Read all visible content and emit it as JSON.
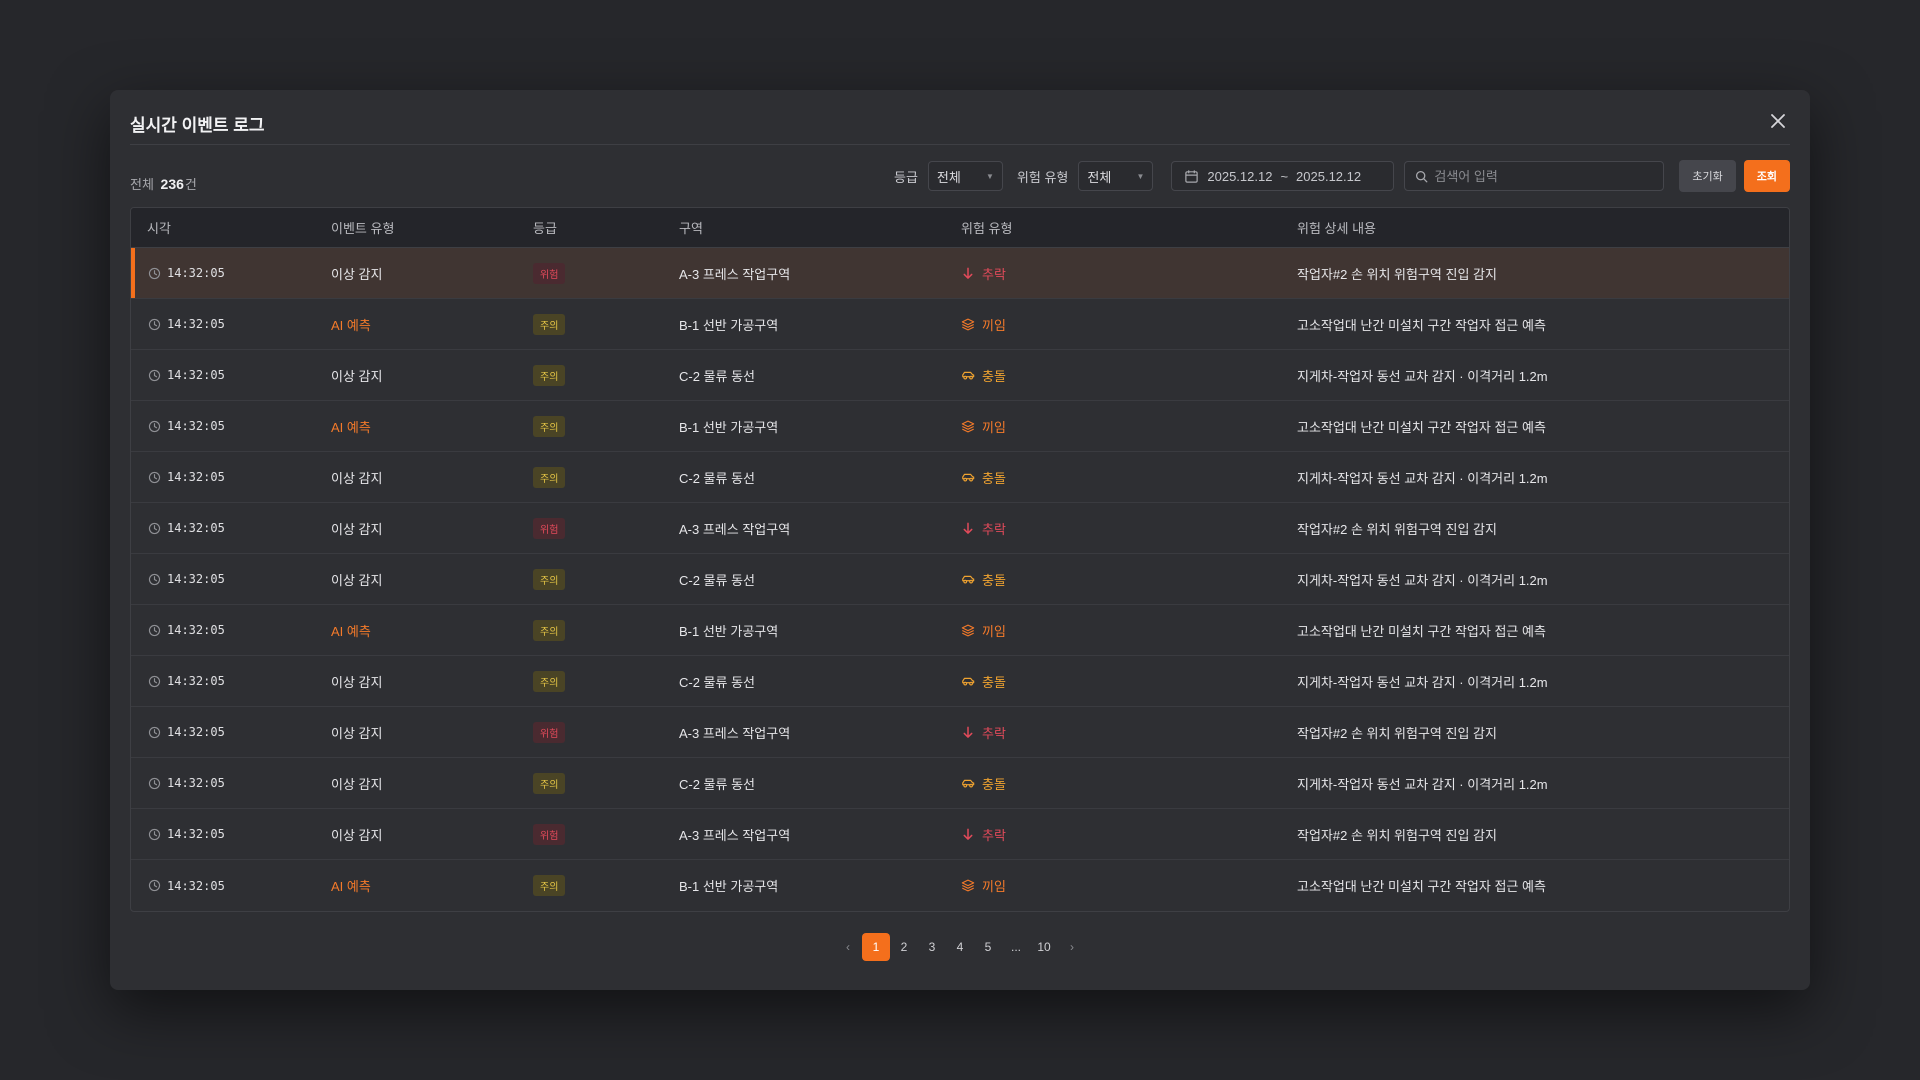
{
  "modal": {
    "title": "실시간 이벤트 로그"
  },
  "toolbar": {
    "total_prefix": "전체",
    "total_count": "236",
    "total_suffix": "건",
    "grade_label": "등급",
    "grade_value": "전체",
    "risk_label": "위험 유형",
    "risk_value": "전체",
    "date_start": "2025.12.12",
    "date_sep": "~",
    "date_end": "2025.12.12",
    "search_placeholder": "검색어 입력",
    "reset_label": "초기화",
    "search_label": "조회"
  },
  "table": {
    "headers": [
      "시각",
      "이벤트 유형",
      "등급",
      "구역",
      "위험 유형",
      "위험 상세 내용"
    ],
    "rows": [
      {
        "time": "14:32:05",
        "type": "이상 감지",
        "type_kind": "normal",
        "grade": "위험",
        "grade_kind": "danger",
        "zone": "A-3 프레스 작업구역",
        "risk": "추락",
        "risk_kind": "fall",
        "detail": "작업자#2 손 위치 위험구역 진입 감지",
        "highlight": true
      },
      {
        "time": "14:32:05",
        "type": "AI 예측",
        "type_kind": "ai",
        "grade": "주의",
        "grade_kind": "warn",
        "zone": "B-1 선반 가공구역",
        "risk": "끼임",
        "risk_kind": "caught",
        "detail": "고소작업대 난간 미설치 구간 작업자 접근 예측"
      },
      {
        "time": "14:32:05",
        "type": "이상 감지",
        "type_kind": "normal",
        "grade": "주의",
        "grade_kind": "warn",
        "zone": "C-2 물류 동선",
        "risk": "충돌",
        "risk_kind": "collision",
        "detail": "지게차-작업자 동선 교차 감지 · 이격거리 1.2m"
      },
      {
        "time": "14:32:05",
        "type": "AI 예측",
        "type_kind": "ai",
        "grade": "주의",
        "grade_kind": "warn",
        "zone": "B-1 선반 가공구역",
        "risk": "끼임",
        "risk_kind": "caught",
        "detail": "고소작업대 난간 미설치 구간 작업자 접근 예측"
      },
      {
        "time": "14:32:05",
        "type": "이상 감지",
        "type_kind": "normal",
        "grade": "주의",
        "grade_kind": "warn",
        "zone": "C-2 물류 동선",
        "risk": "충돌",
        "risk_kind": "collision",
        "detail": "지게차-작업자 동선 교차 감지 · 이격거리 1.2m"
      },
      {
        "time": "14:32:05",
        "type": "이상 감지",
        "type_kind": "normal",
        "grade": "위험",
        "grade_kind": "danger",
        "zone": "A-3 프레스 작업구역",
        "risk": "추락",
        "risk_kind": "fall",
        "detail": "작업자#2 손 위치 위험구역 진입 감지"
      },
      {
        "time": "14:32:05",
        "type": "이상 감지",
        "type_kind": "normal",
        "grade": "주의",
        "grade_kind": "warn",
        "zone": "C-2 물류 동선",
        "risk": "충돌",
        "risk_kind": "collision",
        "detail": "지게차-작업자 동선 교차 감지 · 이격거리 1.2m"
      },
      {
        "time": "14:32:05",
        "type": "AI 예측",
        "type_kind": "ai",
        "grade": "주의",
        "grade_kind": "warn",
        "zone": "B-1 선반 가공구역",
        "risk": "끼임",
        "risk_kind": "caught",
        "detail": "고소작업대 난간 미설치 구간 작업자 접근 예측"
      },
      {
        "time": "14:32:05",
        "type": "이상 감지",
        "type_kind": "normal",
        "grade": "주의",
        "grade_kind": "warn",
        "zone": "C-2 물류 동선",
        "risk": "충돌",
        "risk_kind": "collision",
        "detail": "지게차-작업자 동선 교차 감지 · 이격거리 1.2m"
      },
      {
        "time": "14:32:05",
        "type": "이상 감지",
        "type_kind": "normal",
        "grade": "위험",
        "grade_kind": "danger",
        "zone": "A-3 프레스 작업구역",
        "risk": "추락",
        "risk_kind": "fall",
        "detail": "작업자#2 손 위치 위험구역 진입 감지"
      },
      {
        "time": "14:32:05",
        "type": "이상 감지",
        "type_kind": "normal",
        "grade": "주의",
        "grade_kind": "warn",
        "zone": "C-2 물류 동선",
        "risk": "충돌",
        "risk_kind": "collision",
        "detail": "지게차-작업자 동선 교차 감지 · 이격거리 1.2m"
      },
      {
        "time": "14:32:05",
        "type": "이상 감지",
        "type_kind": "normal",
        "grade": "위험",
        "grade_kind": "danger",
        "zone": "A-3 프레스 작업구역",
        "risk": "추락",
        "risk_kind": "fall",
        "detail": "작업자#2 손 위치 위험구역 진입 감지"
      },
      {
        "time": "14:32:05",
        "type": "AI 예측",
        "type_kind": "ai",
        "grade": "주의",
        "grade_kind": "warn",
        "zone": "B-1 선반 가공구역",
        "risk": "끼임",
        "risk_kind": "caught",
        "detail": "고소작업대 난간 미설치 구간 작업자 접근 예측"
      }
    ]
  },
  "pagination": {
    "pages": [
      "1",
      "2",
      "3",
      "4",
      "5",
      "...",
      "10"
    ],
    "active": "1"
  },
  "colors": {
    "accent": "#f46f1c",
    "danger": "#e24a5a",
    "warn": "#e4c445"
  },
  "icons": {
    "clock": "clock-icon",
    "fall": "arrow-down-icon",
    "caught": "layers-icon",
    "collision": "vehicle-icon",
    "calendar": "calendar-icon",
    "search": "search-icon",
    "close": "close-icon"
  }
}
